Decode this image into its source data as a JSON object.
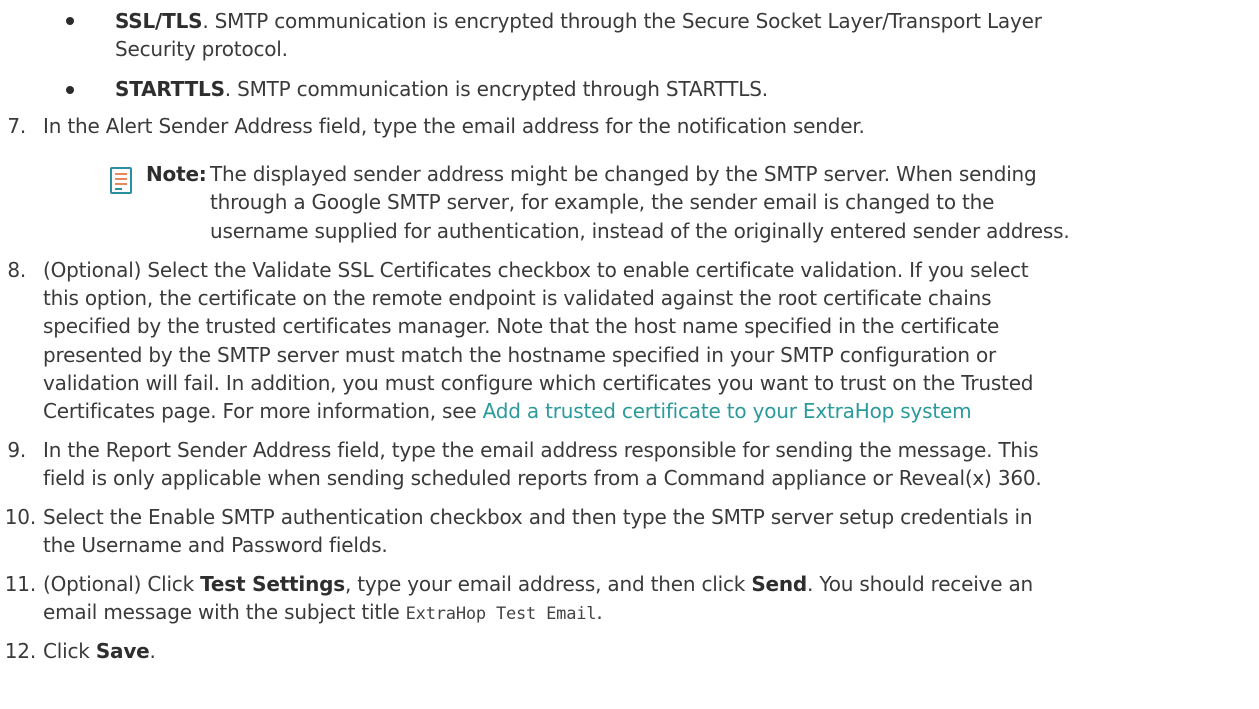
{
  "bullets": [
    {
      "term": "SSL/TLS",
      "line1": ". SMTP communication is encrypted through the Secure Socket Layer/Transport Layer",
      "line2": "Security protocol."
    },
    {
      "term": "STARTTLS",
      "line1": ". SMTP communication is encrypted through STARTTLS."
    }
  ],
  "step7": {
    "num": "7.",
    "text": "In the Alert Sender Address field, type the email address for the notification sender."
  },
  "note": {
    "label": "Note:",
    "line1": "The displayed sender address might be changed by the SMTP server. When sending",
    "line2": "through a Google SMTP server, for example, the sender email is changed to the",
    "line3": "username supplied for authentication, instead of the originally entered sender address."
  },
  "step8": {
    "num": "8.",
    "line1": "(Optional) Select the Validate SSL Certificates checkbox to enable certificate validation. If you select",
    "line2": "this option, the certificate on the remote endpoint is validated against the root certificate chains",
    "line3": "specified by the trusted certificates manager. Note that the host name specified in the certificate",
    "line4": "presented by the SMTP server must match the hostname specified in your SMTP configuration or",
    "line5": "validation will fail. In addition, you must configure which certificates you want to trust on the Trusted",
    "line6_prefix": "Certificates page. For more information, see ",
    "link": "Add a trusted certificate to your ExtraHop system"
  },
  "step9": {
    "num": "9.",
    "line1": "In the Report Sender Address field, type the email address responsible for sending the message. This",
    "line2": "field is only applicable when sending scheduled reports from a Command appliance or Reveal(x) 360."
  },
  "step10": {
    "num": "10.",
    "line1": "Select the Enable SMTP authentication checkbox and then type the SMTP server setup credentials in",
    "line2": "the Username and Password fields."
  },
  "step11": {
    "num": "11.",
    "pre": "(Optional) Click ",
    "b1": "Test Settings",
    "mid": ", type your email address, and then click ",
    "b2": "Send",
    "post": ". You should receive an",
    "line2_pre": "email message with the subject title ",
    "code": "ExtraHop Test Email",
    "line2_post": "."
  },
  "step12": {
    "num": "12.",
    "pre": "Click ",
    "b": "Save",
    "post": "."
  }
}
